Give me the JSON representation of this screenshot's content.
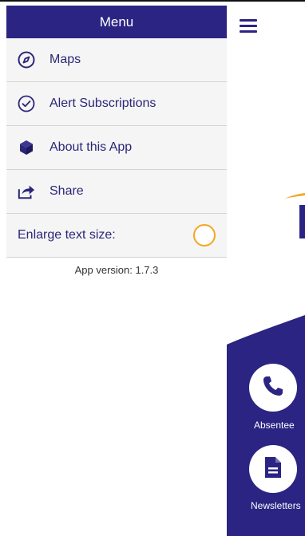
{
  "menu": {
    "title": "Menu",
    "items": [
      {
        "label": "Maps",
        "icon": "compass-icon"
      },
      {
        "label": "Alert Subscriptions",
        "icon": "check-circle-icon"
      },
      {
        "label": "About this App",
        "icon": "cube-icon"
      },
      {
        "label": "Share",
        "icon": "share-arrow-icon"
      }
    ],
    "enlarge_label": "Enlarge text size:",
    "version": "App version: 1.7.3"
  },
  "main": {
    "tiles": [
      {
        "label": "Absentee",
        "icon": "phone-icon"
      },
      {
        "label": "Newsletters",
        "icon": "document-icon"
      }
    ]
  },
  "colors": {
    "brand": "#2b2483",
    "accent": "#f5a623"
  }
}
